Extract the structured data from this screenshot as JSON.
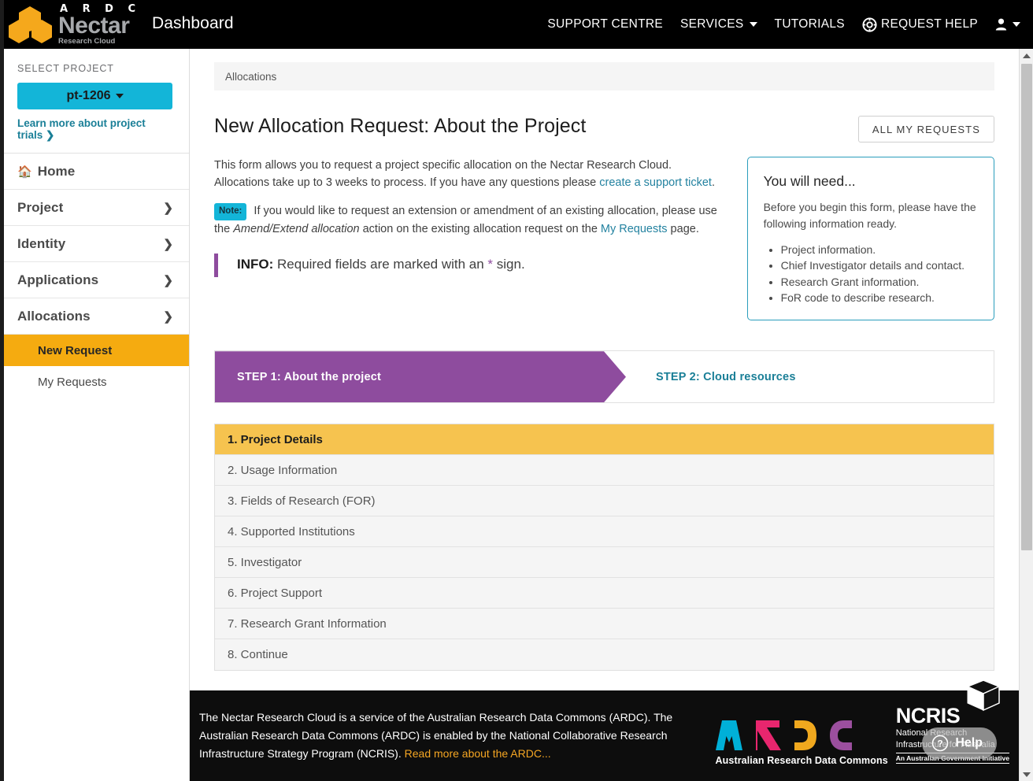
{
  "header": {
    "brand": {
      "ardc_letters": "A R D C",
      "nectar_name": "Nectar",
      "nectar_sub": "Research Cloud",
      "app_title": "Dashboard"
    },
    "nav": [
      {
        "label": "SUPPORT CENTRE",
        "has_caret": false,
        "icon": ""
      },
      {
        "label": "SERVICES",
        "has_caret": true,
        "icon": ""
      },
      {
        "label": "TUTORIALS",
        "has_caret": false,
        "icon": ""
      },
      {
        "label": "REQUEST HELP",
        "has_caret": false,
        "icon": "lifebuoy-icon"
      }
    ],
    "user_menu_label": "user-account"
  },
  "sidebar": {
    "select_project_label": "SELECT PROJECT",
    "project_button": "pt-1206",
    "trials_link": "Learn more about project trials",
    "trials_chevron": "❯",
    "items": [
      {
        "label": "Home",
        "icon": "home-icon",
        "arrow": ""
      },
      {
        "label": "Project",
        "icon": "",
        "arrow": "❯"
      },
      {
        "label": "Identity",
        "icon": "",
        "arrow": "❯"
      },
      {
        "label": "Applications",
        "icon": "",
        "arrow": "❯"
      },
      {
        "label": "Allocations",
        "icon": "",
        "arrow": "❯"
      }
    ],
    "sub_items": [
      {
        "label": "New Request",
        "active": true
      },
      {
        "label": "My Requests",
        "active": false
      }
    ]
  },
  "main": {
    "breadcrumb": "Allocations",
    "page_title": "New Allocation Request: About the Project",
    "all_requests_button": "ALL MY REQUESTS",
    "intro_part1": "This form allows you to request a project specific allocation on the Nectar Research Cloud. Allocations take up to 3 weeks to process. If you have any questions please ",
    "intro_link": "create a support ticket",
    "intro_part2": ".",
    "note_badge": "Note:",
    "note_part1": " If you would like to request an extension or amendment of an existing allocation, please use the ",
    "note_italic": "Amend/Extend allocation",
    "note_part2": " action on the existing allocation request on the ",
    "note_link": "My Requests",
    "note_part3": " page.",
    "info_label": "INFO:",
    "info_text_part1": " Required fields are marked with an ",
    "info_star": "*",
    "info_text_part2": " sign.",
    "need_box": {
      "title": "You will need...",
      "subtitle": "Before you begin this form, please have the following information ready.",
      "items": [
        "Project information.",
        "Chief Investigator details and contact.",
        "Research Grant information.",
        "FoR code to describe research."
      ]
    },
    "steps": [
      {
        "label": "STEP 1: About the project",
        "active": true
      },
      {
        "label": "STEP 2: Cloud resources",
        "active": false
      }
    ],
    "accordion": [
      {
        "label": "1. Project Details",
        "active": true
      },
      {
        "label": "2. Usage Information",
        "active": false
      },
      {
        "label": "3. Fields of Research (FOR)",
        "active": false
      },
      {
        "label": "4. Supported Institutions",
        "active": false
      },
      {
        "label": "5. Investigator",
        "active": false
      },
      {
        "label": "6. Project Support",
        "active": false
      },
      {
        "label": "7. Research Grant Information",
        "active": false
      },
      {
        "label": "8. Continue",
        "active": false
      }
    ]
  },
  "footer": {
    "text": "The Nectar Research Cloud is a service of the Australian Research Data Commons (ARDC). The Australian Research Data Commons (ARDC) is enabled by the National Collaborative Research Infrastructure Strategy Program (NCRIS). ",
    "link": "Read more about the ARDC...",
    "ardc_caption": "Australian Research Data Commons",
    "ncris_word": "NCRIS",
    "ncris_sub_line1": "National Research",
    "ncris_sub_line2": "Infrastructure for Australia",
    "ncris_gov": "An Australian Government Initiative",
    "help_label": "Help"
  },
  "colors": {
    "accent_cyan": "#13b5d8",
    "accent_gold": "#f5ab10",
    "accent_purple": "#8e4c9e",
    "accordion_active": "#f6c34f",
    "link_teal": "#1a7f97",
    "footer_link": "#f5a623",
    "ardc_a": "#00b0d8",
    "ardc_r": "#e8266e",
    "ardc_d": "#f0a81e",
    "ardc_c": "#9b4f9e"
  }
}
